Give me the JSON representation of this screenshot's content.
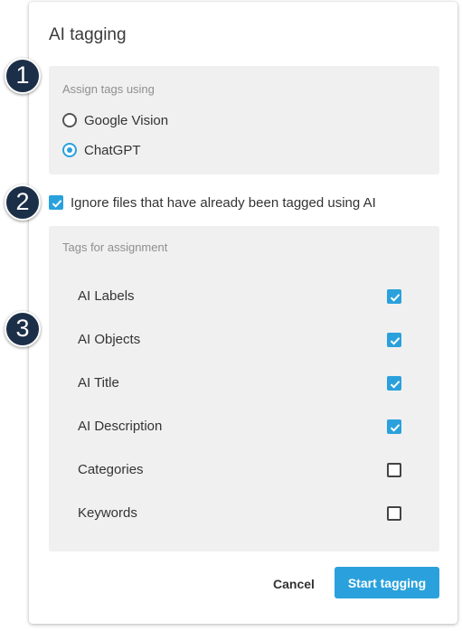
{
  "dialog": {
    "title": "AI tagging",
    "assign_section": {
      "caption": "Assign tags using",
      "options": [
        {
          "label": "Google Vision",
          "selected": false
        },
        {
          "label": "ChatGPT",
          "selected": true
        }
      ]
    },
    "ignore_option": {
      "label": "Ignore files that have already been tagged using AI",
      "checked": true
    },
    "tags_section": {
      "caption": "Tags for assignment",
      "items": [
        {
          "label": "AI Labels",
          "checked": true
        },
        {
          "label": "AI Objects",
          "checked": true
        },
        {
          "label": "AI Title",
          "checked": true
        },
        {
          "label": "AI Description",
          "checked": true
        },
        {
          "label": "Categories",
          "checked": false
        },
        {
          "label": "Keywords",
          "checked": false
        }
      ]
    },
    "buttons": {
      "cancel": "Cancel",
      "start": "Start tagging"
    }
  },
  "annotations": [
    "1",
    "2",
    "3"
  ],
  "colors": {
    "accent": "#2aa1dc",
    "badge": "#1c2f48",
    "panel": "#f0f0f0"
  },
  "icons": {
    "checkbox_checked": "check-icon"
  }
}
